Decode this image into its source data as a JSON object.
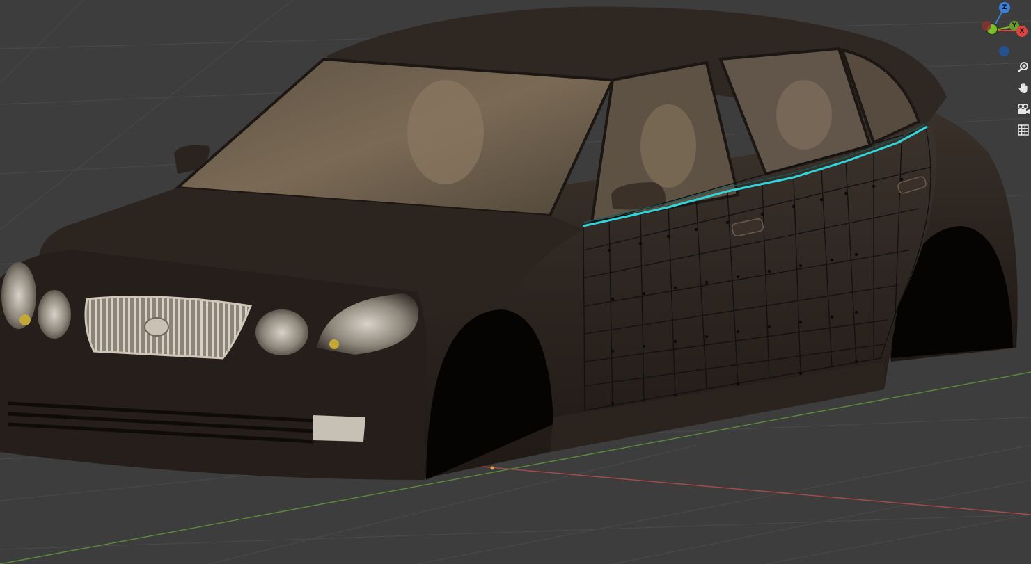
{
  "viewport": {
    "background": "#3d3d3d",
    "grid_line_color": "#4a4a4a",
    "x_axis_color": "#a84b4b",
    "y_axis_color": "#5d8a3a",
    "car_body_color": "#2e2621",
    "selection_edge_color": "#2fd6dc"
  },
  "gizmo": {
    "z_label": "Z",
    "y_label": "Y",
    "x_label": "X",
    "x_color": "#e2423f",
    "y_color": "#7bbf2a",
    "z_color": "#3d7fd6"
  },
  "nav_tools": [
    {
      "name": "zoom",
      "icon": "zoom-icon"
    },
    {
      "name": "pan",
      "icon": "hand-icon"
    },
    {
      "name": "camera",
      "icon": "camera-icon"
    },
    {
      "name": "perspective",
      "icon": "grid-icon"
    }
  ]
}
